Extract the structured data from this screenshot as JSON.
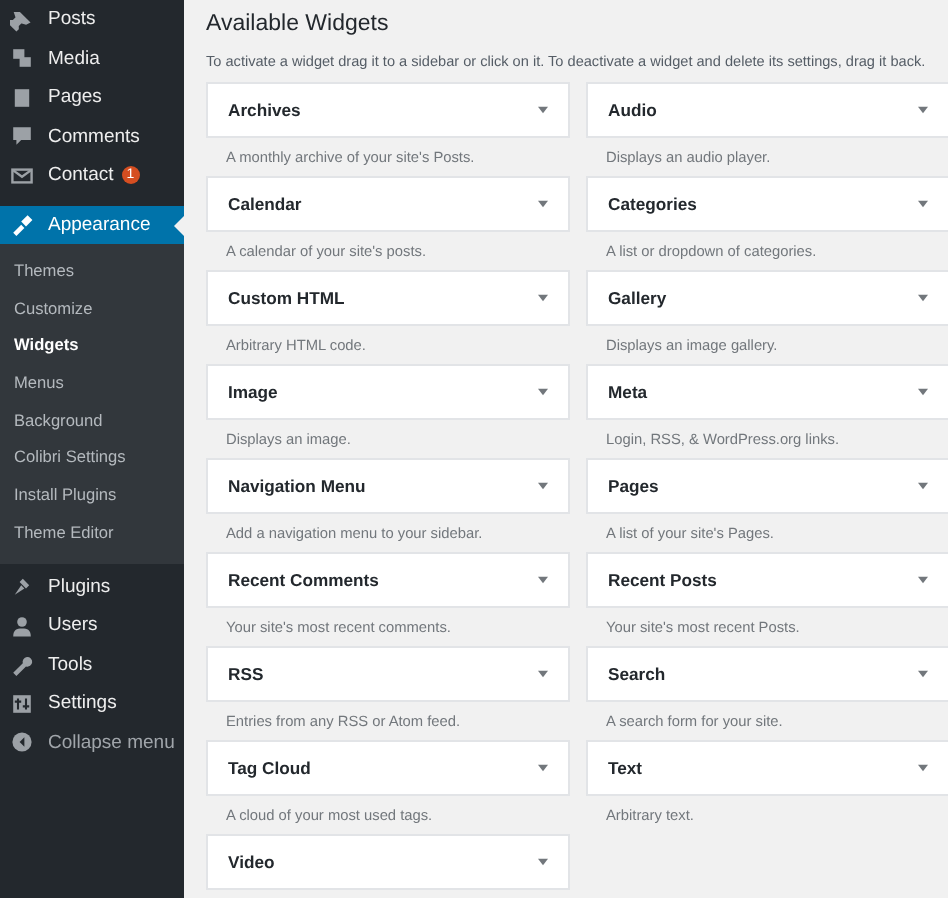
{
  "sidebar": {
    "items": [
      {
        "label": "Posts",
        "selected": false
      },
      {
        "label": "Media",
        "selected": false
      },
      {
        "label": "Pages",
        "selected": false
      },
      {
        "label": "Comments",
        "selected": false
      },
      {
        "label": "Contact",
        "selected": false,
        "badge": "1"
      },
      {
        "label": "Appearance",
        "selected": true,
        "children": [
          {
            "label": "Themes",
            "selected": false
          },
          {
            "label": "Customize",
            "selected": false
          },
          {
            "label": "Widgets",
            "selected": true
          },
          {
            "label": "Menus",
            "selected": false
          },
          {
            "label": "Background",
            "selected": false
          },
          {
            "label": "Colibri Settings",
            "selected": false
          },
          {
            "label": "Install Plugins",
            "selected": false
          },
          {
            "label": "Theme Editor",
            "selected": false
          }
        ]
      },
      {
        "label": "Plugins",
        "selected": false
      },
      {
        "label": "Users",
        "selected": false
      },
      {
        "label": "Tools",
        "selected": false
      },
      {
        "label": "Settings",
        "selected": false
      },
      {
        "label": "Collapse menu",
        "selected": false,
        "kind": "collapse"
      }
    ]
  },
  "main": {
    "title": "Available Widgets",
    "description": "To activate a widget drag it to a sidebar or click on it. To deactivate a widget and delete its settings, drag it back.",
    "widgets": [
      {
        "name": "Archives",
        "description": "A monthly archive of your site's Posts."
      },
      {
        "name": "Audio",
        "description": "Displays an audio player."
      },
      {
        "name": "Calendar",
        "description": "A calendar of your site's posts."
      },
      {
        "name": "Categories",
        "description": "A list or dropdown of categories."
      },
      {
        "name": "Custom HTML",
        "description": "Arbitrary HTML code."
      },
      {
        "name": "Gallery",
        "description": "Displays an image gallery."
      },
      {
        "name": "Image",
        "description": "Displays an image."
      },
      {
        "name": "Meta",
        "description": "Login, RSS, & WordPress.org links."
      },
      {
        "name": "Navigation Menu",
        "description": "Add a navigation menu to your sidebar."
      },
      {
        "name": "Pages",
        "description": "A list of your site's Pages."
      },
      {
        "name": "Recent Comments",
        "description": "Your site's most recent comments."
      },
      {
        "name": "Recent Posts",
        "description": "Your site's most recent Posts."
      },
      {
        "name": "RSS",
        "description": "Entries from any RSS or Atom feed."
      },
      {
        "name": "Search",
        "description": "A search form for your site."
      },
      {
        "name": "Tag Cloud",
        "description": "A cloud of your most used tags."
      },
      {
        "name": "Text",
        "description": "Arbitrary text."
      },
      {
        "name": "Video"
      }
    ]
  }
}
